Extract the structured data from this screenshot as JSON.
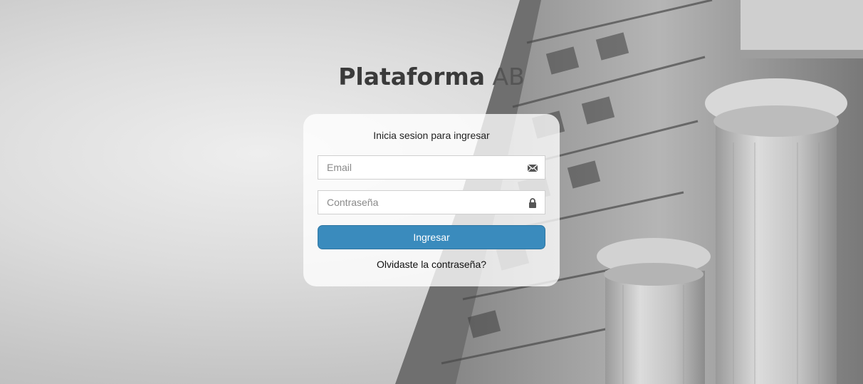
{
  "brand": {
    "bold": "Plataforma",
    "light": "AB"
  },
  "login": {
    "title": "Inicia sesion para ingresar",
    "email_placeholder": "Email",
    "password_placeholder": "Contraseña",
    "submit_label": "Ingresar",
    "forgot_label": "Olvidaste la contraseña?"
  },
  "icons": {
    "email": "envelope-icon",
    "password": "lock-icon"
  },
  "colors": {
    "accent": "#3a8bbd",
    "title": "#3a3a3a"
  }
}
